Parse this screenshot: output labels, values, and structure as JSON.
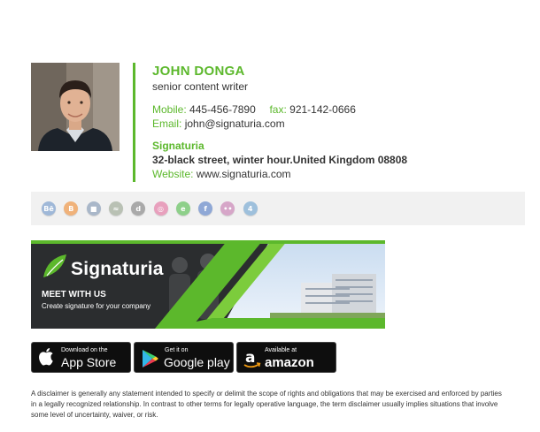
{
  "signature": {
    "name": "JOHN DONGA",
    "job_title": "senior content writer",
    "mobile_label": "Mobile:",
    "mobile": "445-456-7890",
    "fax_label": "fax:",
    "fax": "921-142-0666",
    "email_label": "Email:",
    "email": "john@signaturia.com",
    "company": "Signaturia",
    "address": "32-black street, winter hour.United Kingdom 08808",
    "website_label": "Website:",
    "website": "www.signaturia.com"
  },
  "social_icons": [
    {
      "name": "behance-icon",
      "glyph": "Bē",
      "color": "#9fb8d8"
    },
    {
      "name": "blogger-icon",
      "glyph": "B",
      "color": "#f0b27a"
    },
    {
      "name": "delicious-icon",
      "glyph": "■",
      "color": "#a9b7c9"
    },
    {
      "name": "deviantart-icon",
      "glyph": "≈",
      "color": "#b9c1b4"
    },
    {
      "name": "digg-icon",
      "glyph": "d",
      "color": "#a9a9a9"
    },
    {
      "name": "dribbble-icon",
      "glyph": "◎",
      "color": "#e8a0bd"
    },
    {
      "name": "evernote-icon",
      "glyph": "e",
      "color": "#8ed08a"
    },
    {
      "name": "facebook-icon",
      "glyph": "f",
      "color": "#8fa8d6"
    },
    {
      "name": "flickr-icon",
      "glyph": "••",
      "color": "#d6a6c8"
    },
    {
      "name": "foursquare-icon",
      "glyph": "4",
      "color": "#9ec0dc"
    }
  ],
  "banner": {
    "brand": "Signaturia",
    "headline": "MEET WITH US",
    "subtext": "Create signature for your company"
  },
  "stores": {
    "apple_small": "Download on the",
    "apple_big": "App Store",
    "google_small": "Get it on",
    "google_big": "Google play",
    "amazon_small": "Available at",
    "amazon_big": "amazon"
  },
  "disclaimer": "A disclaimer is generally any statement intended to specify or delimit the scope of rights and obligations that may be exercised and enforced by parties in a legally recognized relationship. In contrast to other terms for legally operative language, the term disclaimer usually implies situations that involve some level of uncertainty, waiver, or risk.",
  "colors": {
    "accent": "#5cb82c",
    "text": "#333333",
    "banner_dark": "#2b2d2f"
  }
}
